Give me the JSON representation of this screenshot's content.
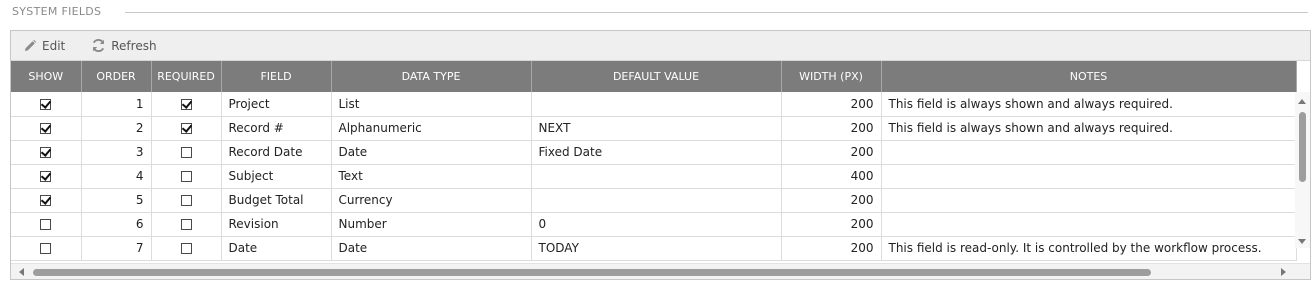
{
  "section": {
    "title": "SYSTEM FIELDS"
  },
  "toolbar": {
    "edit_label": "Edit",
    "edit_icon": "pencil-icon",
    "refresh_label": "Refresh",
    "refresh_icon": "refresh-icon"
  },
  "table": {
    "columns": [
      "SHOW",
      "ORDER",
      "REQUIRED",
      "FIELD",
      "DATA TYPE",
      "DEFAULT VALUE",
      "WIDTH (PX)",
      "NOTES"
    ],
    "rows": [
      {
        "show": true,
        "order": "1",
        "required": true,
        "field": "Project",
        "data_type": "List",
        "default_value": "",
        "width": "200",
        "notes": "This field is always shown and always required."
      },
      {
        "show": true,
        "order": "2",
        "required": true,
        "field": "Record #",
        "data_type": "Alphanumeric",
        "default_value": "NEXT",
        "width": "200",
        "notes": "This field is always shown and always required."
      },
      {
        "show": true,
        "order": "3",
        "required": false,
        "field": "Record Date",
        "data_type": "Date",
        "default_value": "Fixed Date",
        "width": "200",
        "notes": ""
      },
      {
        "show": true,
        "order": "4",
        "required": false,
        "field": "Subject",
        "data_type": "Text",
        "default_value": "",
        "width": "400",
        "notes": ""
      },
      {
        "show": true,
        "order": "5",
        "required": false,
        "field": "Budget Total",
        "data_type": "Currency",
        "default_value": "",
        "width": "200",
        "notes": ""
      },
      {
        "show": false,
        "order": "6",
        "required": false,
        "field": "Revision",
        "data_type": "Number",
        "default_value": "0",
        "width": "200",
        "notes": ""
      },
      {
        "show": false,
        "order": "7",
        "required": false,
        "field": "Date",
        "data_type": "Date",
        "default_value": "TODAY",
        "width": "200",
        "notes": "This field is read-only. It is controlled by the workflow process."
      }
    ]
  },
  "colors": {
    "header_bg": "#7c7c7c",
    "toolbar_bg": "#efefef",
    "border": "#dcdcdc"
  }
}
